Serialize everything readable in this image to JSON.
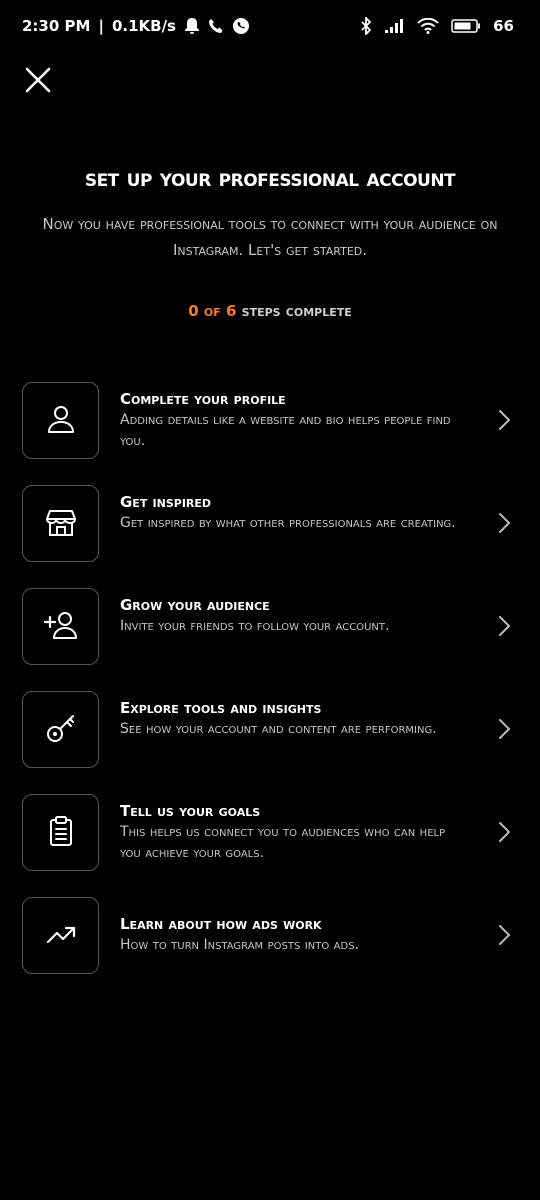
{
  "status_bar": {
    "time": "2:30 PM",
    "network_speed": "0.1KB/s",
    "battery": "66"
  },
  "header": {
    "close_icon": "close-icon",
    "title": "Set up your professional account",
    "subtitle": "Now you have professional tools to connect with your audience on Instagram. Let's get started."
  },
  "progress": {
    "completed": "0",
    "of": "of",
    "total": "6",
    "label": "steps complete"
  },
  "steps": [
    {
      "icon": "person-icon",
      "title": "Complete your profile",
      "description": "Adding details like a website and bio helps people find you."
    },
    {
      "icon": "shop-icon",
      "title": "Get inspired",
      "description": "Get inspired by what other professionals are creating."
    },
    {
      "icon": "add-person-icon",
      "title": "Grow your audience",
      "description": "Invite your friends to follow your account."
    },
    {
      "icon": "key-icon",
      "title": "Explore tools and insights",
      "description": "See how your account and content are performing."
    },
    {
      "icon": "clipboard-icon",
      "title": "Tell us your goals",
      "description": "This helps us connect you to audiences who can help you achieve your goals."
    },
    {
      "icon": "trending-up-icon",
      "title": "Learn about how ads work",
      "description": "How to turn Instagram posts into ads."
    }
  ],
  "colors": {
    "accent": "#ff7a1a",
    "background": "#000000",
    "text_secondary": "#c4c4c4",
    "border": "#555555"
  }
}
